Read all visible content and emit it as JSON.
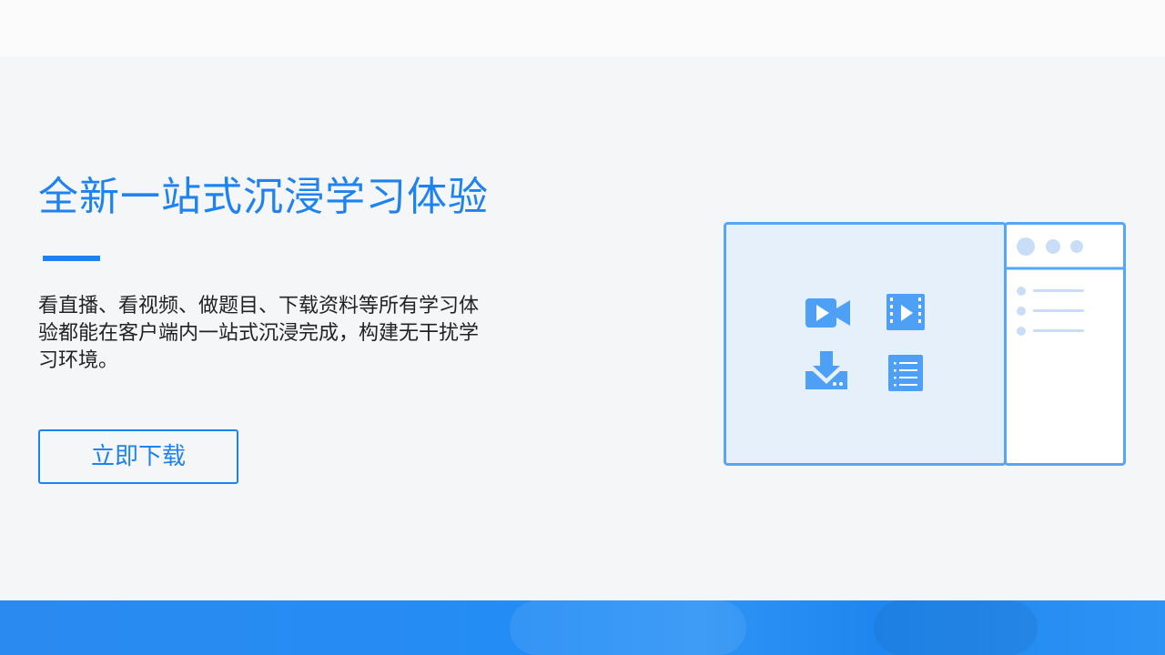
{
  "hero": {
    "title": "全新一站式沉浸学习体验",
    "description": "看直播、看视频、做题目、下载资料等所有学习体验都能在客户端内一站式沉浸完成，构建无干扰学习环境。",
    "download_label": "立即下载"
  },
  "illustration": {
    "icons": [
      "video-camera-icon",
      "film-play-icon",
      "download-icon",
      "document-list-icon"
    ]
  },
  "colors": {
    "accent": "#1e82f0",
    "illustration_stroke": "#55a6f6",
    "illustration_fill": "#e6f0fb",
    "icon": "#4ea0f7",
    "page_bg": "#f4f6f8",
    "band": "#248df5"
  }
}
